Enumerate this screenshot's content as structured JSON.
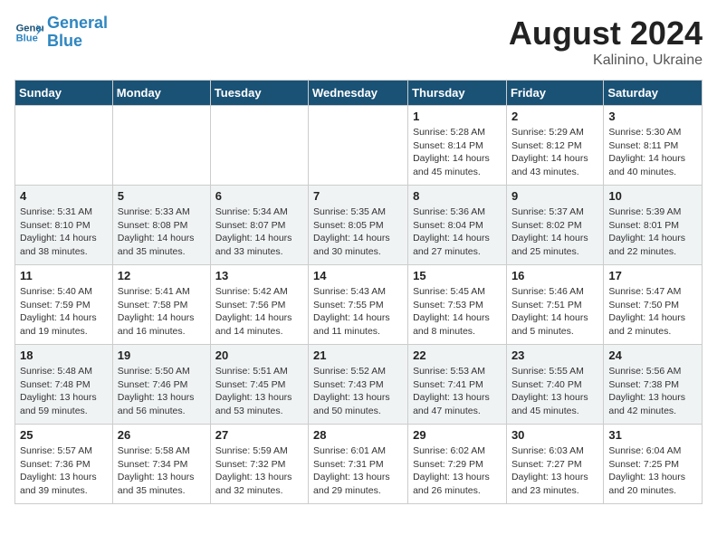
{
  "header": {
    "logo_line1": "General",
    "logo_line2": "Blue",
    "month_year": "August 2024",
    "location": "Kalinino, Ukraine"
  },
  "weekdays": [
    "Sunday",
    "Monday",
    "Tuesday",
    "Wednesday",
    "Thursday",
    "Friday",
    "Saturday"
  ],
  "weeks": [
    [
      {
        "day": "",
        "info": ""
      },
      {
        "day": "",
        "info": ""
      },
      {
        "day": "",
        "info": ""
      },
      {
        "day": "",
        "info": ""
      },
      {
        "day": "1",
        "info": "Sunrise: 5:28 AM\nSunset: 8:14 PM\nDaylight: 14 hours\nand 45 minutes."
      },
      {
        "day": "2",
        "info": "Sunrise: 5:29 AM\nSunset: 8:12 PM\nDaylight: 14 hours\nand 43 minutes."
      },
      {
        "day": "3",
        "info": "Sunrise: 5:30 AM\nSunset: 8:11 PM\nDaylight: 14 hours\nand 40 minutes."
      }
    ],
    [
      {
        "day": "4",
        "info": "Sunrise: 5:31 AM\nSunset: 8:10 PM\nDaylight: 14 hours\nand 38 minutes."
      },
      {
        "day": "5",
        "info": "Sunrise: 5:33 AM\nSunset: 8:08 PM\nDaylight: 14 hours\nand 35 minutes."
      },
      {
        "day": "6",
        "info": "Sunrise: 5:34 AM\nSunset: 8:07 PM\nDaylight: 14 hours\nand 33 minutes."
      },
      {
        "day": "7",
        "info": "Sunrise: 5:35 AM\nSunset: 8:05 PM\nDaylight: 14 hours\nand 30 minutes."
      },
      {
        "day": "8",
        "info": "Sunrise: 5:36 AM\nSunset: 8:04 PM\nDaylight: 14 hours\nand 27 minutes."
      },
      {
        "day": "9",
        "info": "Sunrise: 5:37 AM\nSunset: 8:02 PM\nDaylight: 14 hours\nand 25 minutes."
      },
      {
        "day": "10",
        "info": "Sunrise: 5:39 AM\nSunset: 8:01 PM\nDaylight: 14 hours\nand 22 minutes."
      }
    ],
    [
      {
        "day": "11",
        "info": "Sunrise: 5:40 AM\nSunset: 7:59 PM\nDaylight: 14 hours\nand 19 minutes."
      },
      {
        "day": "12",
        "info": "Sunrise: 5:41 AM\nSunset: 7:58 PM\nDaylight: 14 hours\nand 16 minutes."
      },
      {
        "day": "13",
        "info": "Sunrise: 5:42 AM\nSunset: 7:56 PM\nDaylight: 14 hours\nand 14 minutes."
      },
      {
        "day": "14",
        "info": "Sunrise: 5:43 AM\nSunset: 7:55 PM\nDaylight: 14 hours\nand 11 minutes."
      },
      {
        "day": "15",
        "info": "Sunrise: 5:45 AM\nSunset: 7:53 PM\nDaylight: 14 hours\nand 8 minutes."
      },
      {
        "day": "16",
        "info": "Sunrise: 5:46 AM\nSunset: 7:51 PM\nDaylight: 14 hours\nand 5 minutes."
      },
      {
        "day": "17",
        "info": "Sunrise: 5:47 AM\nSunset: 7:50 PM\nDaylight: 14 hours\nand 2 minutes."
      }
    ],
    [
      {
        "day": "18",
        "info": "Sunrise: 5:48 AM\nSunset: 7:48 PM\nDaylight: 13 hours\nand 59 minutes."
      },
      {
        "day": "19",
        "info": "Sunrise: 5:50 AM\nSunset: 7:46 PM\nDaylight: 13 hours\nand 56 minutes."
      },
      {
        "day": "20",
        "info": "Sunrise: 5:51 AM\nSunset: 7:45 PM\nDaylight: 13 hours\nand 53 minutes."
      },
      {
        "day": "21",
        "info": "Sunrise: 5:52 AM\nSunset: 7:43 PM\nDaylight: 13 hours\nand 50 minutes."
      },
      {
        "day": "22",
        "info": "Sunrise: 5:53 AM\nSunset: 7:41 PM\nDaylight: 13 hours\nand 47 minutes."
      },
      {
        "day": "23",
        "info": "Sunrise: 5:55 AM\nSunset: 7:40 PM\nDaylight: 13 hours\nand 45 minutes."
      },
      {
        "day": "24",
        "info": "Sunrise: 5:56 AM\nSunset: 7:38 PM\nDaylight: 13 hours\nand 42 minutes."
      }
    ],
    [
      {
        "day": "25",
        "info": "Sunrise: 5:57 AM\nSunset: 7:36 PM\nDaylight: 13 hours\nand 39 minutes."
      },
      {
        "day": "26",
        "info": "Sunrise: 5:58 AM\nSunset: 7:34 PM\nDaylight: 13 hours\nand 35 minutes."
      },
      {
        "day": "27",
        "info": "Sunrise: 5:59 AM\nSunset: 7:32 PM\nDaylight: 13 hours\nand 32 minutes."
      },
      {
        "day": "28",
        "info": "Sunrise: 6:01 AM\nSunset: 7:31 PM\nDaylight: 13 hours\nand 29 minutes."
      },
      {
        "day": "29",
        "info": "Sunrise: 6:02 AM\nSunset: 7:29 PM\nDaylight: 13 hours\nand 26 minutes."
      },
      {
        "day": "30",
        "info": "Sunrise: 6:03 AM\nSunset: 7:27 PM\nDaylight: 13 hours\nand 23 minutes."
      },
      {
        "day": "31",
        "info": "Sunrise: 6:04 AM\nSunset: 7:25 PM\nDaylight: 13 hours\nand 20 minutes."
      }
    ]
  ]
}
